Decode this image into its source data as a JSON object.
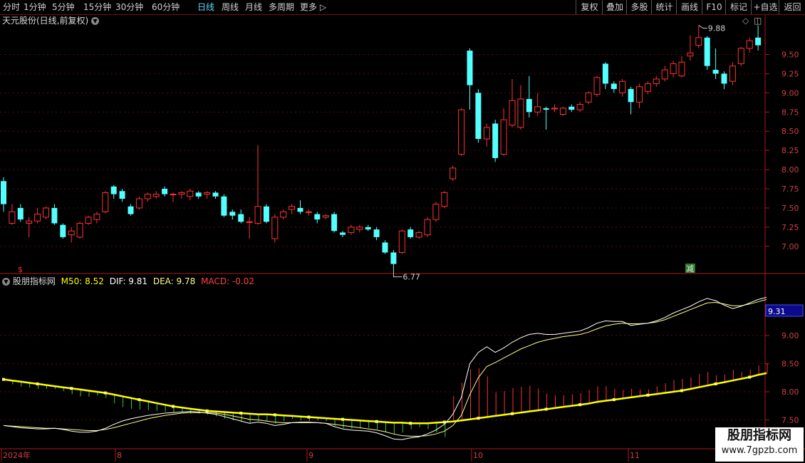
{
  "toolbar": {
    "periods": [
      "分时",
      "1分钟",
      "5分钟",
      "15分钟",
      "30分钟",
      "60分钟",
      "日线",
      "周线",
      "月线",
      "多周期",
      "更多"
    ],
    "active_period": "日线",
    "buttons": [
      "复权",
      "叠加",
      "多股",
      "统计",
      "画线",
      "F10",
      "标记",
      "+自选",
      "返回"
    ]
  },
  "main_chart": {
    "title": "天元股份(日线,前复权)",
    "high_label": "9.88",
    "low_label": "6.77",
    "markers": [
      "$",
      "减"
    ]
  },
  "indicator": {
    "name": "股朋指标网",
    "m50_label": "M50: 8.52",
    "dif_label": "DIF: 9.81",
    "dea_label": "DEA: 9.78",
    "macd_label": "MACD: -0.02",
    "current_value": "9.31"
  },
  "x_axis": [
    "2024年",
    "8",
    "9",
    "10",
    "11"
  ],
  "watermark": {
    "line1": "股朋指标网",
    "line2": "www.7gpzb.com"
  },
  "colors": {
    "up": "#ff3232",
    "down": "#54ffff",
    "frame": "#b01818",
    "m50": "#ffff00",
    "dea": "#ffff88",
    "dif": "#ffffff"
  },
  "chart_data": {
    "type": "candlestick",
    "price_axis_ticks": [
      7.0,
      7.25,
      7.5,
      7.75,
      8.0,
      8.25,
      8.5,
      8.75,
      9.0,
      9.25,
      9.5
    ],
    "indicator_axis_ticks": [
      7.5,
      8.0,
      8.5,
      9.0
    ],
    "low": 6.77,
    "high": 9.88,
    "candles": [
      [
        7.85,
        7.55,
        7.45,
        7.9
      ],
      [
        7.3,
        7.45,
        7.28,
        7.55
      ],
      [
        7.5,
        7.35,
        7.32,
        7.55
      ],
      [
        7.3,
        7.33,
        7.12,
        7.38
      ],
      [
        7.33,
        7.42,
        7.3,
        7.5
      ],
      [
        7.38,
        7.5,
        7.35,
        7.52
      ],
      [
        7.5,
        7.3,
        7.28,
        7.55
      ],
      [
        7.28,
        7.12,
        7.1,
        7.3
      ],
      [
        7.15,
        7.2,
        7.05,
        7.25
      ],
      [
        7.12,
        7.3,
        7.1,
        7.32
      ],
      [
        7.3,
        7.38,
        7.28,
        7.4
      ],
      [
        7.35,
        7.42,
        7.3,
        7.45
      ],
      [
        7.45,
        7.7,
        7.43,
        7.72
      ],
      [
        7.78,
        7.68,
        7.62,
        7.8
      ],
      [
        7.72,
        7.62,
        7.58,
        7.75
      ],
      [
        7.52,
        7.42,
        7.4,
        7.55
      ],
      [
        7.5,
        7.62,
        7.48,
        7.65
      ],
      [
        7.62,
        7.68,
        7.58,
        7.7
      ],
      [
        7.65,
        7.68,
        7.62,
        7.72
      ],
      [
        7.75,
        7.68,
        7.65,
        7.78
      ],
      [
        7.68,
        7.68,
        7.58,
        7.7
      ],
      [
        7.68,
        7.7,
        7.62,
        7.72
      ],
      [
        7.65,
        7.72,
        7.6,
        7.75
      ],
      [
        7.7,
        7.65,
        7.62,
        7.72
      ],
      [
        7.68,
        7.7,
        7.62,
        7.72
      ],
      [
        7.7,
        7.65,
        7.62,
        7.72
      ],
      [
        7.65,
        7.4,
        7.38,
        7.68
      ],
      [
        7.45,
        7.4,
        7.35,
        7.48
      ],
      [
        7.42,
        7.32,
        7.3,
        7.48
      ],
      [
        7.32,
        7.32,
        7.1,
        7.38
      ],
      [
        7.3,
        7.52,
        7.28,
        8.32
      ],
      [
        7.52,
        7.32,
        7.3,
        7.55
      ],
      [
        7.1,
        7.38,
        7.05,
        7.42
      ],
      [
        7.38,
        7.45,
        7.35,
        7.48
      ],
      [
        7.48,
        7.52,
        7.42,
        7.55
      ],
      [
        7.5,
        7.45,
        7.42,
        7.6
      ],
      [
        7.45,
        7.45,
        7.4,
        7.48
      ],
      [
        7.42,
        7.35,
        7.3,
        7.45
      ],
      [
        7.38,
        7.4,
        7.35,
        7.42
      ],
      [
        7.42,
        7.2,
        7.18,
        7.45
      ],
      [
        7.18,
        7.15,
        7.12,
        7.2
      ],
      [
        7.18,
        7.25,
        7.15,
        7.28
      ],
      [
        7.22,
        7.25,
        7.18,
        7.28
      ],
      [
        7.25,
        7.22,
        7.2,
        7.28
      ],
      [
        7.22,
        7.12,
        7.08,
        7.25
      ],
      [
        7.05,
        6.92,
        6.9,
        7.08
      ],
      [
        6.92,
        6.77,
        6.77,
        6.95
      ],
      [
        6.92,
        7.2,
        6.9,
        7.22
      ],
      [
        7.22,
        7.12,
        7.1,
        7.25
      ],
      [
        7.12,
        7.18,
        7.1,
        7.2
      ],
      [
        7.15,
        7.35,
        7.12,
        7.38
      ],
      [
        7.35,
        7.55,
        7.32,
        7.58
      ],
      [
        7.52,
        7.7,
        7.5,
        7.72
      ],
      [
        7.88,
        8.02,
        7.85,
        8.05
      ],
      [
        8.2,
        8.78,
        8.18,
        8.8
      ],
      [
        9.55,
        9.1,
        8.78,
        9.58
      ],
      [
        9.0,
        8.4,
        8.35,
        9.05
      ],
      [
        8.4,
        8.55,
        8.3,
        8.6
      ],
      [
        8.6,
        8.15,
        8.1,
        8.65
      ],
      [
        8.2,
        8.65,
        8.18,
        8.8
      ],
      [
        8.58,
        8.9,
        8.55,
        9.18
      ],
      [
        8.55,
        8.92,
        8.52,
        9.1
      ],
      [
        8.92,
        8.75,
        8.68,
        9.22
      ],
      [
        8.75,
        8.82,
        8.7,
        9.0
      ],
      [
        8.8,
        8.78,
        8.52,
        8.82
      ],
      [
        8.8,
        8.8,
        8.75,
        8.85
      ],
      [
        8.72,
        8.8,
        8.7,
        8.82
      ],
      [
        8.82,
        8.78,
        8.75,
        8.85
      ],
      [
        8.78,
        8.85,
        8.75,
        8.88
      ],
      [
        8.88,
        9.0,
        8.85,
        9.02
      ],
      [
        8.98,
        9.2,
        8.95,
        9.22
      ],
      [
        9.38,
        9.12,
        9.05,
        9.4
      ],
      [
        9.12,
        9.05,
        9.0,
        9.15
      ],
      [
        9.0,
        9.15,
        8.95,
        9.18
      ],
      [
        9.05,
        8.88,
        8.72,
        9.08
      ],
      [
        8.88,
        9.08,
        8.8,
        9.12
      ],
      [
        9.02,
        9.12,
        8.98,
        9.15
      ],
      [
        9.12,
        9.18,
        9.08,
        9.22
      ],
      [
        9.18,
        9.3,
        9.15,
        9.35
      ],
      [
        9.25,
        9.38,
        9.2,
        9.42
      ],
      [
        9.22,
        9.4,
        9.2,
        9.48
      ],
      [
        9.48,
        9.52,
        9.42,
        9.75
      ],
      [
        9.62,
        9.72,
        9.58,
        9.88
      ],
      [
        9.72,
        9.35,
        9.3,
        9.74
      ],
      [
        9.3,
        9.25,
        9.18,
        9.58
      ],
      [
        9.25,
        9.12,
        9.05,
        9.28
      ],
      [
        9.15,
        9.35,
        9.1,
        9.4
      ],
      [
        9.38,
        9.58,
        9.35,
        9.6
      ],
      [
        9.58,
        9.68,
        9.52,
        9.72
      ],
      [
        9.72,
        9.62,
        9.55,
        9.88
      ]
    ],
    "m50": [
      8.22,
      8.2,
      8.18,
      8.16,
      8.14,
      8.12,
      8.1,
      8.08,
      8.06,
      8.04,
      8.02,
      8.0,
      7.98,
      7.95,
      7.92,
      7.89,
      7.86,
      7.83,
      7.8,
      7.77,
      7.74,
      7.72,
      7.7,
      7.68,
      7.66,
      7.65,
      7.64,
      7.63,
      7.62,
      7.61,
      7.6,
      7.6,
      7.59,
      7.58,
      7.57,
      7.56,
      7.55,
      7.54,
      7.53,
      7.52,
      7.51,
      7.5,
      7.49,
      7.48,
      7.47,
      7.46,
      7.45,
      7.45,
      7.44,
      7.44,
      7.44,
      7.45,
      7.46,
      7.47,
      7.49,
      7.51,
      7.53,
      7.55,
      7.57,
      7.59,
      7.61,
      7.63,
      7.65,
      7.67,
      7.69,
      7.71,
      7.73,
      7.75,
      7.77,
      7.79,
      7.82,
      7.84,
      7.86,
      7.88,
      7.9,
      7.92,
      7.94,
      7.96,
      7.98,
      8.0,
      8.02,
      8.05,
      8.08,
      8.11,
      8.14,
      8.17,
      8.2,
      8.23,
      8.26,
      8.3,
      8.33
    ],
    "dif": [
      7.4,
      7.38,
      7.36,
      7.35,
      7.34,
      7.34,
      7.35,
      7.33,
      7.3,
      7.28,
      7.28,
      7.3,
      7.35,
      7.42,
      7.48,
      7.52,
      7.55,
      7.58,
      7.6,
      7.62,
      7.63,
      7.64,
      7.65,
      7.64,
      7.62,
      7.6,
      7.56,
      7.52,
      7.48,
      7.44,
      7.46,
      7.44,
      7.4,
      7.42,
      7.45,
      7.46,
      7.46,
      7.45,
      7.44,
      7.38,
      7.34,
      7.32,
      7.31,
      7.3,
      7.27,
      7.22,
      7.16,
      7.15,
      7.18,
      7.2,
      7.25,
      7.32,
      7.42,
      7.6,
      7.9,
      8.5,
      8.7,
      8.8,
      8.7,
      8.78,
      8.88,
      8.96,
      9.02,
      9.04,
      9.02,
      9.02,
      9.04,
      9.06,
      9.08,
      9.14,
      9.22,
      9.26,
      9.25,
      9.25,
      9.18,
      9.2,
      9.22,
      9.26,
      9.32,
      9.4,
      9.46,
      9.52,
      9.6,
      9.66,
      9.62,
      9.54,
      9.48,
      9.52,
      9.58,
      9.64,
      9.68
    ],
    "dea": [
      7.4,
      7.39,
      7.38,
      7.37,
      7.36,
      7.35,
      7.35,
      7.34,
      7.33,
      7.32,
      7.31,
      7.31,
      7.33,
      7.36,
      7.4,
      7.44,
      7.48,
      7.52,
      7.55,
      7.58,
      7.6,
      7.62,
      7.63,
      7.63,
      7.63,
      7.62,
      7.6,
      7.57,
      7.54,
      7.51,
      7.5,
      7.48,
      7.46,
      7.45,
      7.45,
      7.45,
      7.45,
      7.45,
      7.44,
      7.42,
      7.4,
      7.38,
      7.36,
      7.34,
      7.32,
      7.29,
      7.25,
      7.22,
      7.21,
      7.21,
      7.22,
      7.25,
      7.3,
      7.4,
      7.58,
      7.95,
      8.25,
      8.45,
      8.52,
      8.6,
      8.68,
      8.76,
      8.82,
      8.88,
      8.92,
      8.95,
      8.98,
      9.0,
      9.02,
      9.06,
      9.12,
      9.17,
      9.2,
      9.22,
      9.21,
      9.21,
      9.22,
      9.24,
      9.28,
      9.34,
      9.4,
      9.46,
      9.52,
      9.58,
      9.59,
      9.56,
      9.53,
      9.53,
      9.56,
      9.6,
      9.64
    ]
  }
}
